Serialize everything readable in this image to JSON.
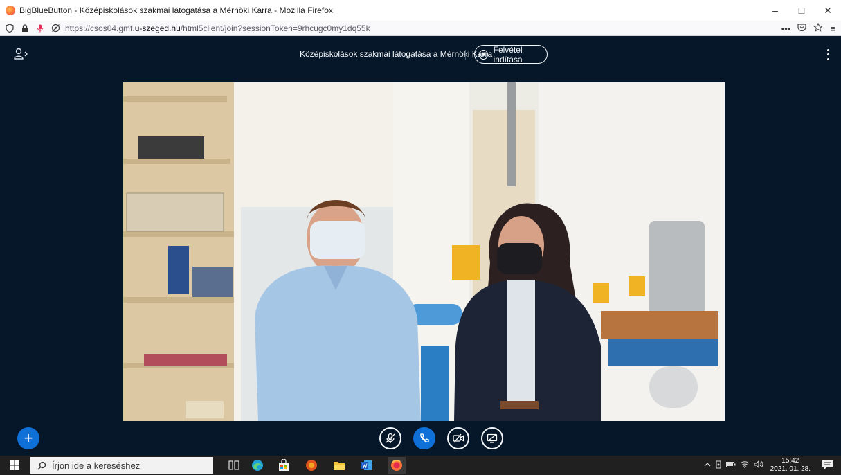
{
  "browser": {
    "window_title": "BigBlueButton - Középiskolások szakmai látogatása a Mérnöki Karra - Mozilla Firefox",
    "url_prefix": "https://csos04.gmf.",
    "url_host": "u-szeged.hu",
    "url_suffix": "/html5client/join?sessionToken=9rhcugc0my1dq55k",
    "controls": {
      "minimize": "–",
      "maximize": "□",
      "close": "✕"
    },
    "toolbar": {
      "more": "•••",
      "menu": "≡"
    }
  },
  "bbb": {
    "meeting_title": "Középiskolások szakmai látogatása a Mérnöki Karra",
    "record_label": "Felvétel indítása",
    "actions_button": "+",
    "controls": [
      "mute-microphone",
      "leave-audio",
      "share-webcam",
      "share-screen"
    ]
  },
  "taskbar": {
    "search_placeholder": "Írjon ide a kereséshez",
    "time": "15:42",
    "date": "2021. 01. 28."
  },
  "colors": {
    "bbb_background": "#06172a",
    "bbb_primary": "#0f70d7",
    "taskbar": "#202020"
  }
}
